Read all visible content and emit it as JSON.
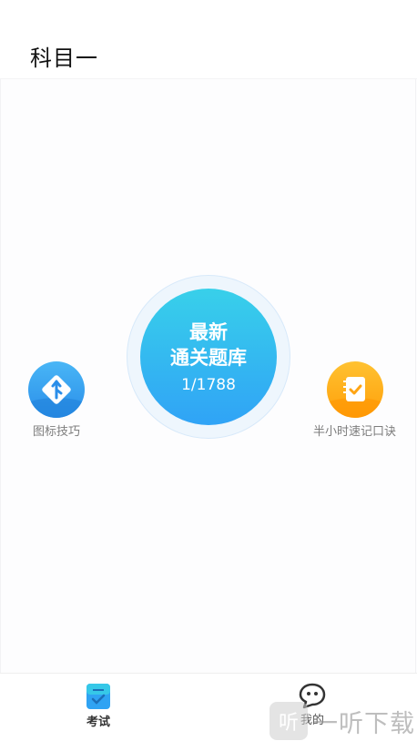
{
  "header": {
    "title": "科目一"
  },
  "main_button": {
    "line1": "最新",
    "line2": "通关题库",
    "progress": "1/1788"
  },
  "shortcuts": {
    "left": {
      "label": "图标技巧",
      "icon": "road-sign-icon"
    },
    "right": {
      "label": "半小时速记口诀",
      "icon": "notebook-check-icon"
    }
  },
  "tabbar": {
    "tabs": [
      {
        "label": "考试",
        "icon": "clipboard-check-icon",
        "active": true
      },
      {
        "label": "我的",
        "icon": "chat-face-icon",
        "active": false
      }
    ]
  },
  "watermark": {
    "logo": "听",
    "text": "一听下载"
  },
  "colors": {
    "accent": "#30a3f6",
    "accent_light": "#38d0ea",
    "orange": "#ffa514",
    "blue_icon": "#2a8ee9"
  }
}
